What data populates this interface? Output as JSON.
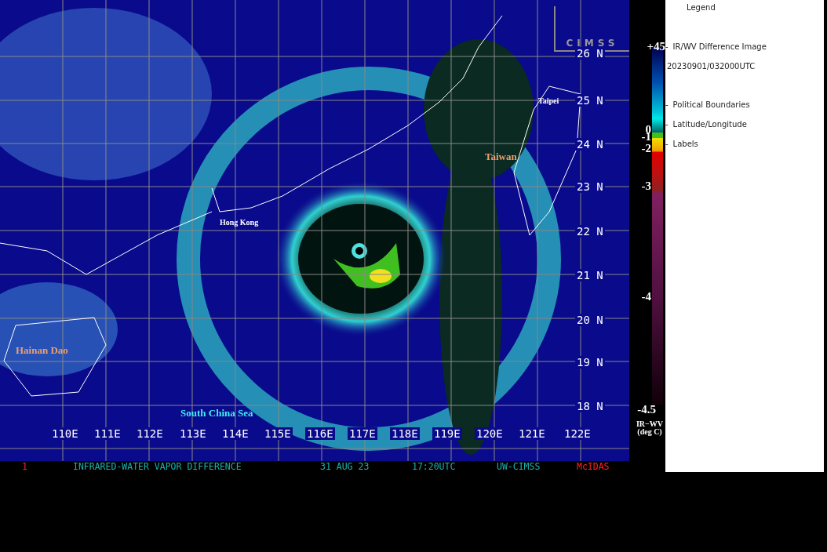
{
  "map": {
    "logo": "CIMSS",
    "latitude_labels": [
      "26 N",
      "25 N",
      "24 N",
      "23 N",
      "22 N",
      "21 N",
      "20 N",
      "19 N",
      "18 N"
    ],
    "longitude_labels": [
      "110E",
      "111E",
      "112E",
      "113E",
      "114E",
      "115E",
      "116E",
      "117E",
      "118E",
      "119E",
      "120E",
      "121E",
      "122E"
    ],
    "place_labels": [
      {
        "text": "Taipei",
        "kind": "city"
      },
      {
        "text": "Taiwan",
        "kind": "land"
      },
      {
        "text": "Hong Kong",
        "kind": "city"
      },
      {
        "text": "Hainan Dao",
        "kind": "land"
      },
      {
        "text": "South China Sea",
        "kind": "sea"
      }
    ]
  },
  "caption": [
    {
      "text": "1",
      "color": "#ff2020"
    },
    {
      "text": "INFRARED-WATER VAPOR DIFFERENCE",
      "color": "#20b0b0"
    },
    {
      "text": "31 AUG 23",
      "color": "#20b0b0"
    },
    {
      "text": "17:20UTC",
      "color": "#20b0b0"
    },
    {
      "text": "UW-CIMSS",
      "color": "#20b0b0"
    },
    {
      "text": "McIDAS",
      "color": "#ff2020"
    }
  ],
  "color_scale": {
    "ticks": [
      "+45",
      "0",
      "-1",
      "-2",
      "-3",
      "-4",
      "-4.5"
    ],
    "unit": [
      "IR−WV",
      "(deg C)"
    ]
  },
  "legend": {
    "title": "Legend",
    "items": [
      {
        "bullet": "-",
        "text": "IR/WV Difference Image"
      },
      {
        "text": "20230901/032000UTC"
      },
      {
        "bullet": "-",
        "text": "Political Boundaries"
      },
      {
        "bullet": "-",
        "text": "Latitude/Longitude"
      },
      {
        "bullet": "-",
        "text": "Labels"
      }
    ]
  }
}
